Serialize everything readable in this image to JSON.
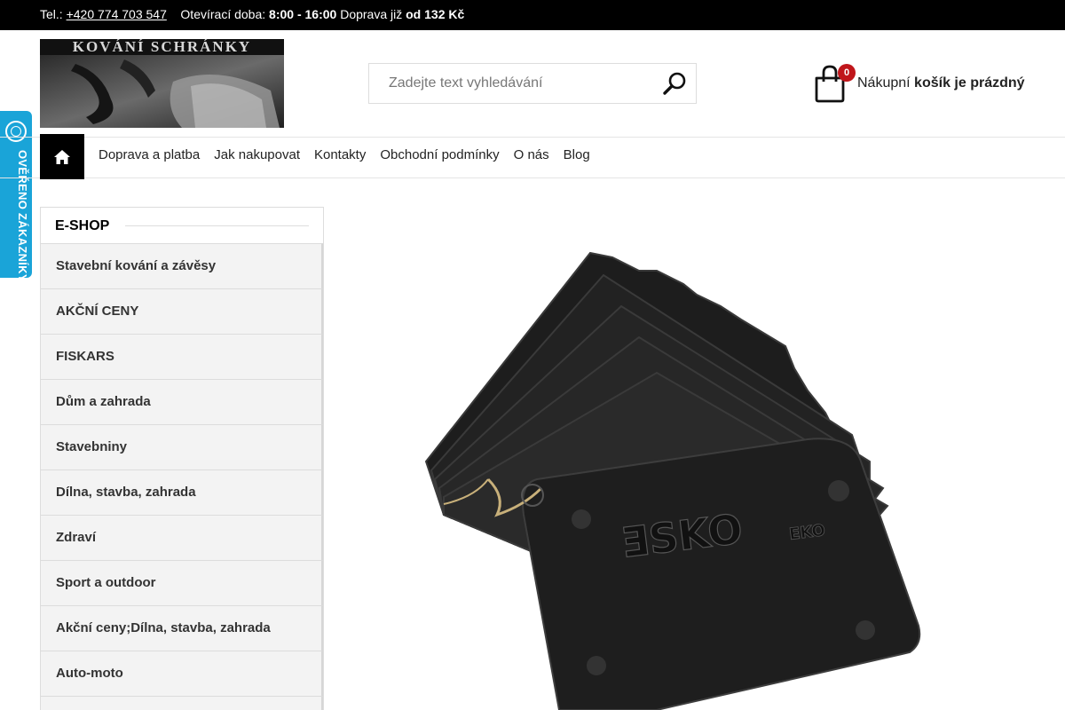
{
  "topbar": {
    "tel_label": "Tel.:",
    "phone": "+420 774 703 547",
    "hours_label": "Otevírací doba:",
    "hours": "8:00 - 16:00",
    "shipping_label": "Doprava již",
    "shipping_price": "od 132 Kč"
  },
  "logo": {
    "text": "KOVÁNÍ SCHRÁNKY"
  },
  "search": {
    "placeholder": "Zadejte text vyhledávání"
  },
  "cart": {
    "count": "0",
    "label": "Nákupní",
    "status": "košík je prázdný"
  },
  "nav": {
    "items": [
      {
        "label": "Doprava a platba"
      },
      {
        "label": "Jak nakupovat"
      },
      {
        "label": "Kontakty"
      },
      {
        "label": "Obchodní podmínky"
      },
      {
        "label": "O nás"
      },
      {
        "label": "Blog"
      }
    ]
  },
  "sidebar": {
    "title": "E-SHOP",
    "items": [
      {
        "label": "Stavební kování a závěsy"
      },
      {
        "label": "AKČNÍ CENY"
      },
      {
        "label": "FISKARS"
      },
      {
        "label": "Dům a zahrada"
      },
      {
        "label": "Stavebniny"
      },
      {
        "label": "Dílna, stavba, zahrada"
      },
      {
        "label": "Zdraví"
      },
      {
        "label": "Sport a outdoor"
      },
      {
        "label": "Akční ceny;Dílna, stavba, zahrada"
      },
      {
        "label": "Auto-moto"
      }
    ]
  },
  "trust_badge": {
    "text": "OVĚŘENO ZÁKAZNÍKY"
  },
  "hero": {
    "brand_text": "ƎSKO",
    "brand_suffix": "EKO"
  },
  "colors": {
    "accent": "#c0161b",
    "trust": "#1aa4d8",
    "topbar": "#000000"
  }
}
